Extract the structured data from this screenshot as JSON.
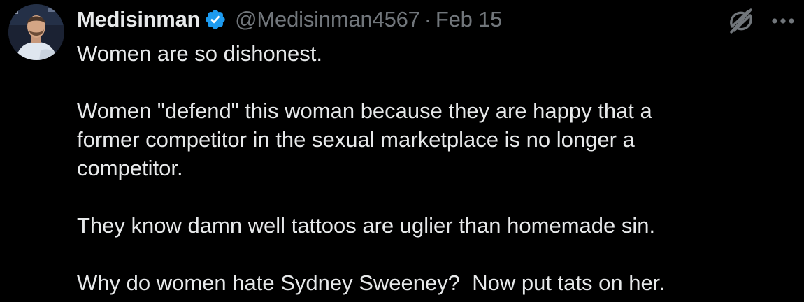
{
  "author": {
    "display_name": "Medisinman",
    "handle": "@Medisinman4567",
    "separator": "·",
    "date": "Feb 15",
    "verified": true
  },
  "icons": {
    "verified": "verified-badge-icon",
    "grok": "grok-icon",
    "more": "more-options-icon",
    "avatar": "avatar"
  },
  "colors": {
    "background": "#000000",
    "text": "#e7e9ea",
    "secondary": "#71767b",
    "verified": "#1d9bf0"
  },
  "tweet": {
    "paragraphs": [
      "Women are so dishonest.",
      "Women \"defend\" this woman because they are happy that a\nformer competitor in the sexual marketplace is no longer a\ncompetitor.",
      "They know damn well tattoos are uglier than homemade sin.",
      "Why do women hate Sydney Sweeney?  Now put tats on her."
    ]
  }
}
